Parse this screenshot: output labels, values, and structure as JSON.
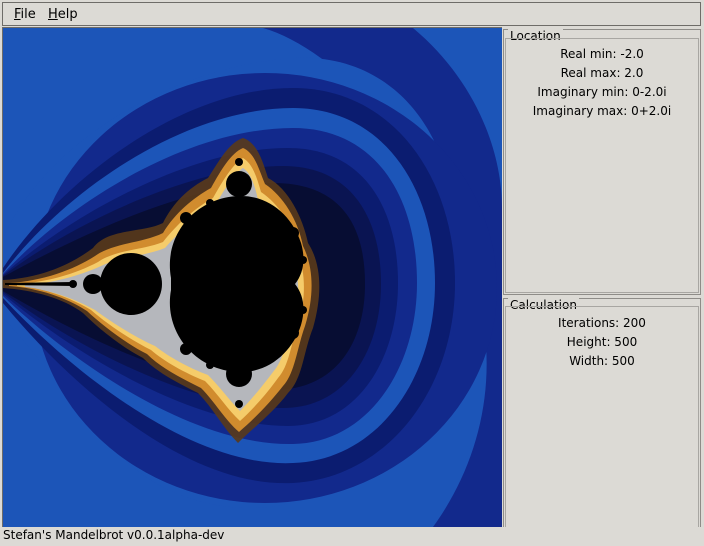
{
  "menu": {
    "file": {
      "first": "F",
      "rest": "ile"
    },
    "help": {
      "first": "H",
      "rest": "elp"
    }
  },
  "fractal": {
    "real_min": -2.0,
    "real_max": 2.0,
    "imag_min": -2.0,
    "imag_max": 2.0,
    "colors": {
      "background_band": "#1c55b8",
      "outer_band": "#12298c",
      "mid_band": "#0b1c70",
      "inner_band": "#0a1452",
      "deep_band": "#070d33",
      "set": "#000000",
      "glow_brown": "#5a3a1a",
      "glow_orange": "#d18c2e",
      "glow_gold": "#f5cc6a",
      "edge_blue": "#7fa6ff"
    }
  },
  "location": {
    "title": "Location",
    "real_min": "Real min: -2.0",
    "real_max": "Real max: 2.0",
    "imag_min": "Imaginary min: 0-2.0i",
    "imag_max": "Imaginary max: 0+2.0i"
  },
  "calculation": {
    "title": "Calculation",
    "iterations": "Iterations: 200",
    "height": "Height: 500",
    "width": "Width: 500"
  },
  "status": {
    "text": "Stefan's Mandelbrot v0.0.1alpha-dev"
  }
}
